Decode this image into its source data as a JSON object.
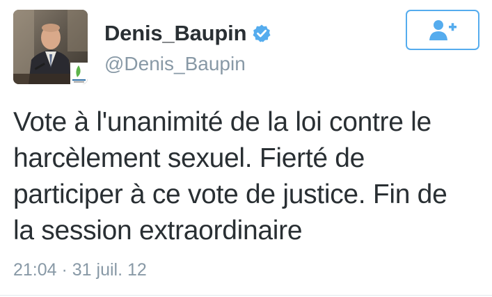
{
  "user": {
    "display_name": "Denis_Baupin",
    "handle": "@Denis_Baupin",
    "verified": true,
    "avatar_icon": "profile-photo"
  },
  "follow_button": {
    "icon": "follow-user-plus-icon"
  },
  "tweet": {
    "text": "Vote à l'unanimité de la loi contre le\nharcèlement sexuel. Fierté de\nparticiper à ce vote de justice. Fin de\nla session extraordinaire",
    "timestamp": "21:04 · 31 juil. 12"
  },
  "colors": {
    "accent": "#55acee",
    "text": "#292f33",
    "muted": "#8899a6"
  }
}
